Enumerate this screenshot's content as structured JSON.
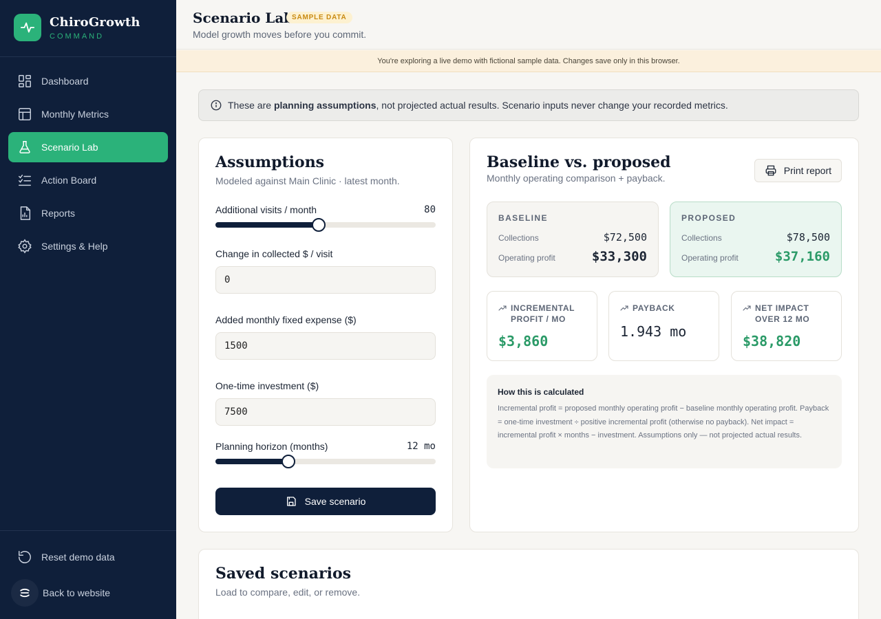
{
  "brand": {
    "name": "ChiroGrowth",
    "sub": "COMMAND"
  },
  "sidebar": {
    "items": [
      {
        "label": "Dashboard",
        "icon": "dashboard-icon"
      },
      {
        "label": "Monthly Metrics",
        "icon": "table-icon"
      },
      {
        "label": "Scenario Lab",
        "icon": "flask-icon",
        "active": true
      },
      {
        "label": "Action Board",
        "icon": "checklist-icon"
      },
      {
        "label": "Reports",
        "icon": "report-icon"
      },
      {
        "label": "Settings & Help",
        "icon": "gear-icon"
      }
    ],
    "reset_label": "Reset demo data",
    "back_label": "Back to website"
  },
  "header": {
    "title": "Scenario Lab",
    "badge": "SAMPLE DATA",
    "subtitle": "Model growth moves before you commit."
  },
  "demo_banner": "You're exploring a live demo with fictional sample data. Changes save only in this browser.",
  "notice": {
    "prefix": "These are ",
    "bold": "planning assumptions",
    "suffix": ", not projected actual results. Scenario inputs never change your recorded metrics."
  },
  "assumptions": {
    "title": "Assumptions",
    "subtitle": "Modeled against Main Clinic · latest month.",
    "visits_label": "Additional visits / month",
    "visits_value": "80",
    "visits_level": 0.47,
    "collected_label": "Change in collected $ / visit",
    "collected_value": "0",
    "fixed_label": "Added monthly fixed expense ($)",
    "fixed_value": "1500",
    "investment_label": "One-time investment ($)",
    "investment_value": "7500",
    "horizon_label": "Planning horizon (months)",
    "horizon_value": "12 mo",
    "horizon_level": 0.33,
    "save_label": "Save scenario"
  },
  "compare": {
    "title": "Baseline vs. proposed",
    "subtitle": "Monthly operating comparison + payback.",
    "print_label": "Print report",
    "baseline": {
      "head": "BASELINE",
      "collections_label": "Collections",
      "collections": "$72,500",
      "profit_label": "Operating profit",
      "profit": "$33,300"
    },
    "proposed": {
      "head": "PROPOSED",
      "collections_label": "Collections",
      "collections": "$78,500",
      "profit_label": "Operating profit",
      "profit": "$37,160"
    },
    "metrics": [
      {
        "label": "INCREMENTAL PROFIT / MO",
        "value": "$3,860"
      },
      {
        "label": "PAYBACK",
        "value": "1.943 mo"
      },
      {
        "label": "NET IMPACT OVER 12 MO",
        "value": "$38,820"
      }
    ],
    "calc_title": "How this is calculated",
    "calc_body": "Incremental profit = proposed monthly operating profit − baseline monthly operating profit. Payback = one-time investment ÷ positive incremental profit (otherwise no payback). Net impact = incremental profit × months − investment. Assumptions only — not projected actual results."
  },
  "saved": {
    "title": "Saved scenarios",
    "subtitle": "Load to compare, edit, or remove."
  },
  "colors": {
    "navy": "#0f1f3a",
    "green": "#2bb27a",
    "accent_green": "#2a9a67",
    "amber": "#c98a12"
  }
}
